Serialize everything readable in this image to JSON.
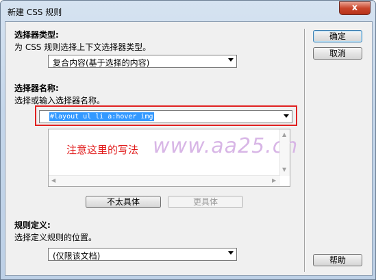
{
  "window": {
    "title": "新建 CSS 规则",
    "close_label": "x"
  },
  "selector_type": {
    "heading": "选择器类型:",
    "description": "为 CSS 规则选择上下文选择器类型。",
    "selected": "复合内容(基于选择的内容)"
  },
  "selector_name": {
    "heading": "选择器名称:",
    "description": "选择或输入选择器名称。",
    "value": "#layout ul li a:hover img",
    "annotation": "注意这里的写法",
    "watermark": "www.aa25.cn",
    "less_specific_label": "不太具体",
    "more_specific_label": "更具体"
  },
  "rule_definition": {
    "heading": "规则定义:",
    "description": "选择定义规则的位置。",
    "selected": "(仅限该文档)"
  },
  "buttons": {
    "ok": "确定",
    "cancel": "取消",
    "help": "帮助"
  },
  "colors": {
    "annotation_red": "#e11b1b",
    "selection_blue": "#3399ff",
    "watermark_purple": "#d8b6e6"
  }
}
